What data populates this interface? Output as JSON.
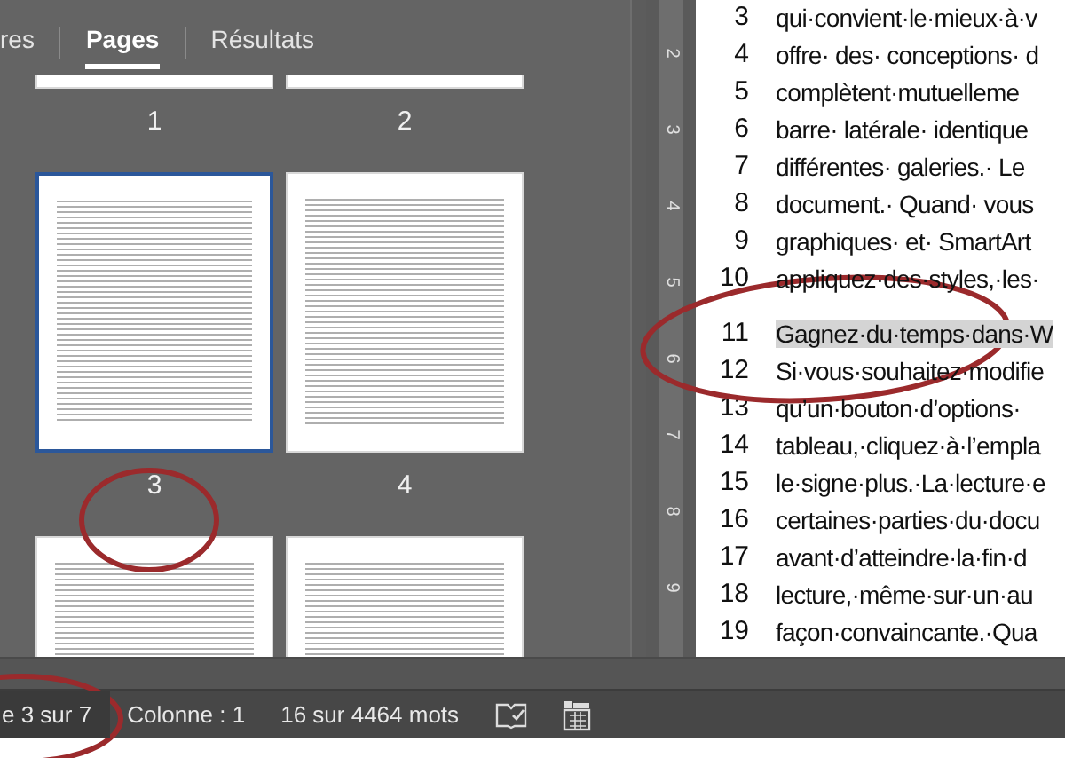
{
  "nav_tabs": [
    {
      "label": "res",
      "selected": false
    },
    {
      "label": "Pages",
      "selected": true
    },
    {
      "label": "Résultats",
      "selected": false
    }
  ],
  "pages": [
    {
      "number": "1",
      "selected": false
    },
    {
      "number": "2",
      "selected": false
    },
    {
      "number": "3",
      "selected": true
    },
    {
      "number": "4",
      "selected": false
    },
    {
      "selected": false
    },
    {
      "selected": false
    }
  ],
  "ruler_marks": [
    "2",
    "3",
    "4",
    "5",
    "6",
    "7",
    "8",
    "9"
  ],
  "document_paragraphs": [
    {
      "lines": [
        {
          "number": "3",
          "text": "qui·convient·le·mieux·à·v",
          "highlighted": false
        },
        {
          "number": "4",
          "text": "offre· des· conceptions· d",
          "highlighted": false
        },
        {
          "number": "5",
          "text": "complètent·mutuelleme",
          "highlighted": false
        },
        {
          "number": "6",
          "text": "barre· latérale· identique",
          "highlighted": false
        },
        {
          "number": "7",
          "text": "différentes· galeries.· Le",
          "highlighted": false
        },
        {
          "number": "8",
          "text": "document.· Quand· vous",
          "highlighted": false
        },
        {
          "number": "9",
          "text": "graphiques· et· SmartArt",
          "highlighted": false
        },
        {
          "number": "10",
          "text": "appliquez·des·styles,·les·",
          "highlighted": false
        }
      ]
    },
    {
      "lines": [
        {
          "number": "11",
          "text": "Gagnez·du·temps·dans·W",
          "highlighted": true
        },
        {
          "number": "12",
          "text": "Si·vous·souhaitez·modifie",
          "highlighted": false
        },
        {
          "number": "13",
          "text": "qu’un·bouton·d’options·",
          "highlighted": false
        },
        {
          "number": "14",
          "text": "tableau,·cliquez·à·l’empla",
          "highlighted": false
        },
        {
          "number": "15",
          "text": "le·signe·plus.·La·lecture·e",
          "highlighted": false
        },
        {
          "number": "16",
          "text": "certaines·parties·du·docu",
          "highlighted": false
        },
        {
          "number": "17",
          "text": "avant·d’atteindre·la·fin·d",
          "highlighted": false
        },
        {
          "number": "18",
          "text": "lecture,·même·sur·un·au",
          "highlighted": false
        },
        {
          "number": "19",
          "text": "façon·convaincante.·Qua",
          "highlighted": false
        }
      ]
    }
  ],
  "status_bar": {
    "items": [
      {
        "text": "e 3 sur 7",
        "highlighted": true
      },
      {
        "text": "Colonne : 1",
        "highlighted": false
      },
      {
        "text": "16 sur 4464 mots",
        "highlighted": false
      }
    ]
  }
}
